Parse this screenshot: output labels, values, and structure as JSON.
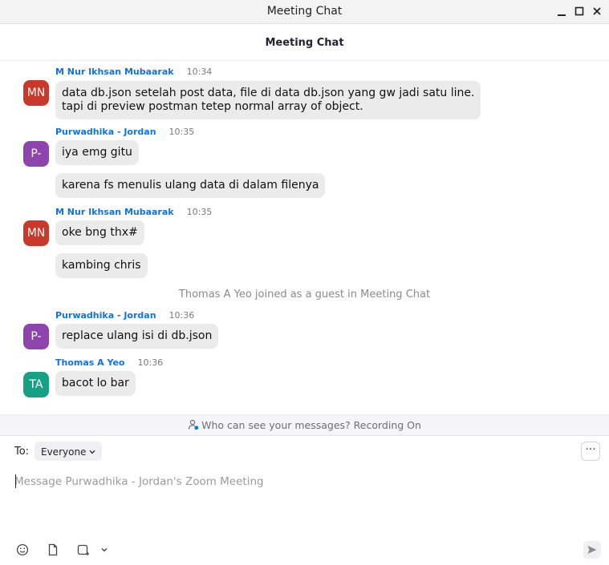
{
  "window": {
    "title": "Meeting Chat"
  },
  "header": {
    "title": "Meeting Chat"
  },
  "messages": [
    {
      "sender": "M Nur Ikhsan Mubaarak",
      "time": "10:34",
      "initials": "MN",
      "avatar_color": "#c9392b",
      "texts": [
        "data db.json setelah post data, file di data db.json yang gw jadi satu line.\ntapi di preview postman tetep normal array of object."
      ]
    },
    {
      "sender": "Purwadhika - Jordan",
      "time": "10:35",
      "initials": "P-",
      "avatar_color": "#8e44ad",
      "texts": [
        "iya emg gitu",
        "karena fs menulis ulang data di dalam filenya"
      ]
    },
    {
      "sender": "M Nur Ikhsan Mubaarak",
      "time": "10:35",
      "initials": "MN",
      "avatar_color": "#c9392b",
      "texts": [
        "oke bng thx#",
        "kambing chris"
      ]
    },
    {
      "system": "Thomas A Yeo joined as a guest in Meeting Chat"
    },
    {
      "sender": "Purwadhika - Jordan",
      "time": "10:36",
      "initials": "P-",
      "avatar_color": "#8e44ad",
      "texts": [
        "replace ulang isi di db.json"
      ]
    },
    {
      "sender": "Thomas A Yeo",
      "time": "10:36",
      "initials": "TA",
      "avatar_color": "#16a085",
      "texts": [
        "bacot lo bar"
      ]
    }
  ],
  "notice": {
    "text": "Who can see your messages? Recording On",
    "icon": "person-visibility-icon"
  },
  "compose": {
    "to_label": "To:",
    "recipient": "Everyone",
    "placeholder": "Message Purwadhika - Jordan's Zoom Meeting",
    "value": "",
    "more_label": "···",
    "tools": [
      "emoji-icon",
      "file-icon",
      "screenshot-icon",
      "chevron-down-icon"
    ],
    "send_icon": "send-icon"
  }
}
